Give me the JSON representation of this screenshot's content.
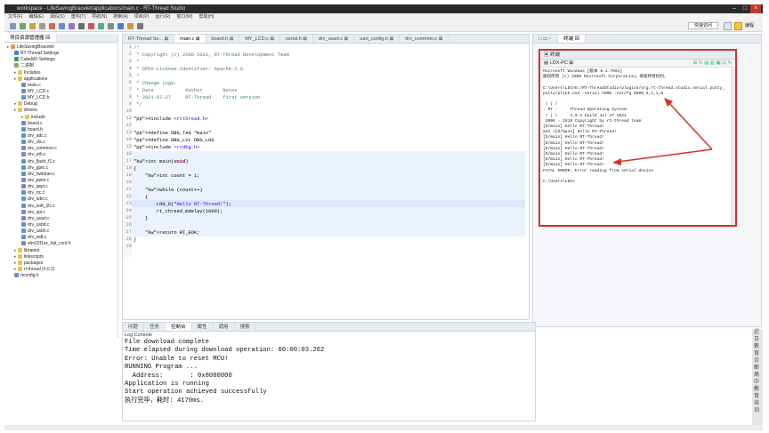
{
  "window": {
    "title": "workspace - LifeSavingBracelet/applications/main.c - RT-Thread Studio",
    "menu": [
      "文件(F)",
      "编辑(E)",
      "源码(S)",
      "重构(T)",
      "导航(N)",
      "搜索(A)",
      "项目(P)",
      "运行(R)",
      "窗口(W)",
      "帮助(H)"
    ],
    "quick_access": "快速访问"
  },
  "explorer": {
    "tab": "项目资源管理器",
    "items": [
      {
        "label": "LifeSavingBracelet",
        "depth": 0,
        "icon": "project"
      },
      {
        "label": "RT-Thread Settings",
        "depth": 1,
        "icon": "settings"
      },
      {
        "label": "CubeMX Settings",
        "depth": 1,
        "icon": "cube"
      },
      {
        "label": "二进制",
        "depth": 1,
        "icon": "binary"
      },
      {
        "label": "Includes",
        "depth": 1,
        "icon": "folder"
      },
      {
        "label": "applications",
        "depth": 1,
        "icon": "folder"
      },
      {
        "label": "main.c",
        "depth": 2,
        "icon": "file"
      },
      {
        "label": "MY_LCD.c",
        "depth": 2,
        "icon": "file"
      },
      {
        "label": "MY_LCD.h",
        "depth": 2,
        "icon": "file"
      },
      {
        "label": "Debug",
        "depth": 1,
        "icon": "folder"
      },
      {
        "label": "drivers",
        "depth": 1,
        "icon": "folder"
      },
      {
        "label": "include",
        "depth": 2,
        "icon": "folder"
      },
      {
        "label": "board.c",
        "depth": 2,
        "icon": "file"
      },
      {
        "label": "board.h",
        "depth": 2,
        "icon": "file"
      },
      {
        "label": "drv_adc.c",
        "depth": 2,
        "icon": "file"
      },
      {
        "label": "drv_clk.c",
        "depth": 2,
        "icon": "file"
      },
      {
        "label": "drv_common.c",
        "depth": 2,
        "icon": "file"
      },
      {
        "label": "drv_eth.c",
        "depth": 2,
        "icon": "file"
      },
      {
        "label": "drv_flash_f1.c",
        "depth": 2,
        "icon": "file"
      },
      {
        "label": "drv_gpio.c",
        "depth": 2,
        "icon": "file"
      },
      {
        "label": "drv_hwtimer.c",
        "depth": 2,
        "icon": "file"
      },
      {
        "label": "drv_pwm.c",
        "depth": 2,
        "icon": "file"
      },
      {
        "label": "drv_qspi.c",
        "depth": 2,
        "icon": "file"
      },
      {
        "label": "drv_rtc.c",
        "depth": 2,
        "icon": "file"
      },
      {
        "label": "drv_sdio.c",
        "depth": 2,
        "icon": "file"
      },
      {
        "label": "drv_soft_i2c.c",
        "depth": 2,
        "icon": "file"
      },
      {
        "label": "drv_spi.c",
        "depth": 2,
        "icon": "file"
      },
      {
        "label": "drv_usart.c",
        "depth": 2,
        "icon": "file"
      },
      {
        "label": "drv_usbd.c",
        "depth": 2,
        "icon": "file"
      },
      {
        "label": "drv_usbh.c",
        "depth": 2,
        "icon": "file"
      },
      {
        "label": "drv_wdt.c",
        "depth": 2,
        "icon": "file"
      },
      {
        "label": "stm32f1xx_hal_conf.h",
        "depth": 2,
        "icon": "file"
      },
      {
        "label": "libraries",
        "depth": 1,
        "icon": "folder"
      },
      {
        "label": "linkscripts",
        "depth": 1,
        "icon": "folder"
      },
      {
        "label": "packages",
        "depth": 1,
        "icon": "folder"
      },
      {
        "label": "rt-thread [4.0.2]",
        "depth": 1,
        "icon": "folder"
      },
      {
        "label": "rtconfig.h",
        "depth": 1,
        "icon": "file"
      }
    ]
  },
  "editor": {
    "tabs": [
      "RT-Thread Se...",
      "main.c",
      "board.h",
      "MY_LCD.c",
      "serial.h",
      "drv_usart.c",
      "uart_config.h",
      "drv_common.c"
    ],
    "active_tab": 1,
    "lines": [
      "/*",
      " * Copyright (c) 2006-2021, RT-Thread Development Team",
      " *",
      " * SPDX-License-Identifier: Apache-2.0",
      " *",
      " * Change Logs:",
      " * Date           Author       Notes",
      " * 2021-07-27     RT-Thread    first version",
      " */",
      "",
      "#include <rtthread.h>",
      "",
      "#define DBG_TAG \"main\"",
      "#define DBG_LVL DBG_LOG",
      "#include <rtdbg.h>",
      "",
      "int main(void)",
      "{",
      "    int count = 1;",
      "",
      "    while (count++)",
      "    {",
      "        LOG_D(\"Hello RT-Thread!\");",
      "        rt_thread_mdelay(1000);",
      "    }",
      "",
      "    return RT_EOK;",
      "}",
      ""
    ]
  },
  "right_panel": {
    "tab": "终端",
    "terminal_tab": "LDX-PC",
    "lines": [
      "Microsoft Windows [版本 6.1.7601]",
      "版权所有 (c) 2009 Microsoft Corporation。保留所有权利。",
      "",
      "C:\\Users\\LDX>D:/RT-ThreadStudio/plugins/org.rt-thread.studio.serial.putty_",
      "putty/plink.exe -serial COM6 -sercfg 9600,8,n,1,N",
      "",
      " \\ | /",
      "- RT -     Thread Operating System",
      " / | \\     4.0.2 build Jul 27 2021",
      " 2006 - 2019 Copyright by rt-thread team",
      "[D/main] Hello RT-Thread!",
      "msh >[D/main] Hello RT-Thread!",
      "[D/main] Hello RT-Thread!",
      "[D/main] Hello RT-Thread!",
      "[D/main] Hello RT-Thread!",
      "[D/main] Hello RT-Thread!",
      "[D/main] Hello RT-Thread!",
      "[D/main] Hello RT-Thread!",
      "FATAL ERROR: Error reading from serial device",
      "",
      "C:\\Users\\LDX>"
    ]
  },
  "bottom": {
    "tabs": [
      "问题",
      "任务",
      "控制台",
      "属性",
      "调用",
      "搜索"
    ],
    "active_tab": 2,
    "console_title": "Log Console",
    "lines": [
      "File download complete",
      "Time elapsed during download operation: 00:00:03.262",
      "Error: Unable to reset MCU!",
      "RUNNING Program ...",
      "  Address:       : 0x8000000",
      "Application is running",
      "Start operation achieved successfully",
      "执行完毕，耗时: 4170ms."
    ]
  },
  "side_text": "近日教育诊断高中教育培训",
  "colors": {
    "highlight_box": "#d0342c",
    "arrow": "#d0342c",
    "active_line": "#e8f2fe"
  }
}
